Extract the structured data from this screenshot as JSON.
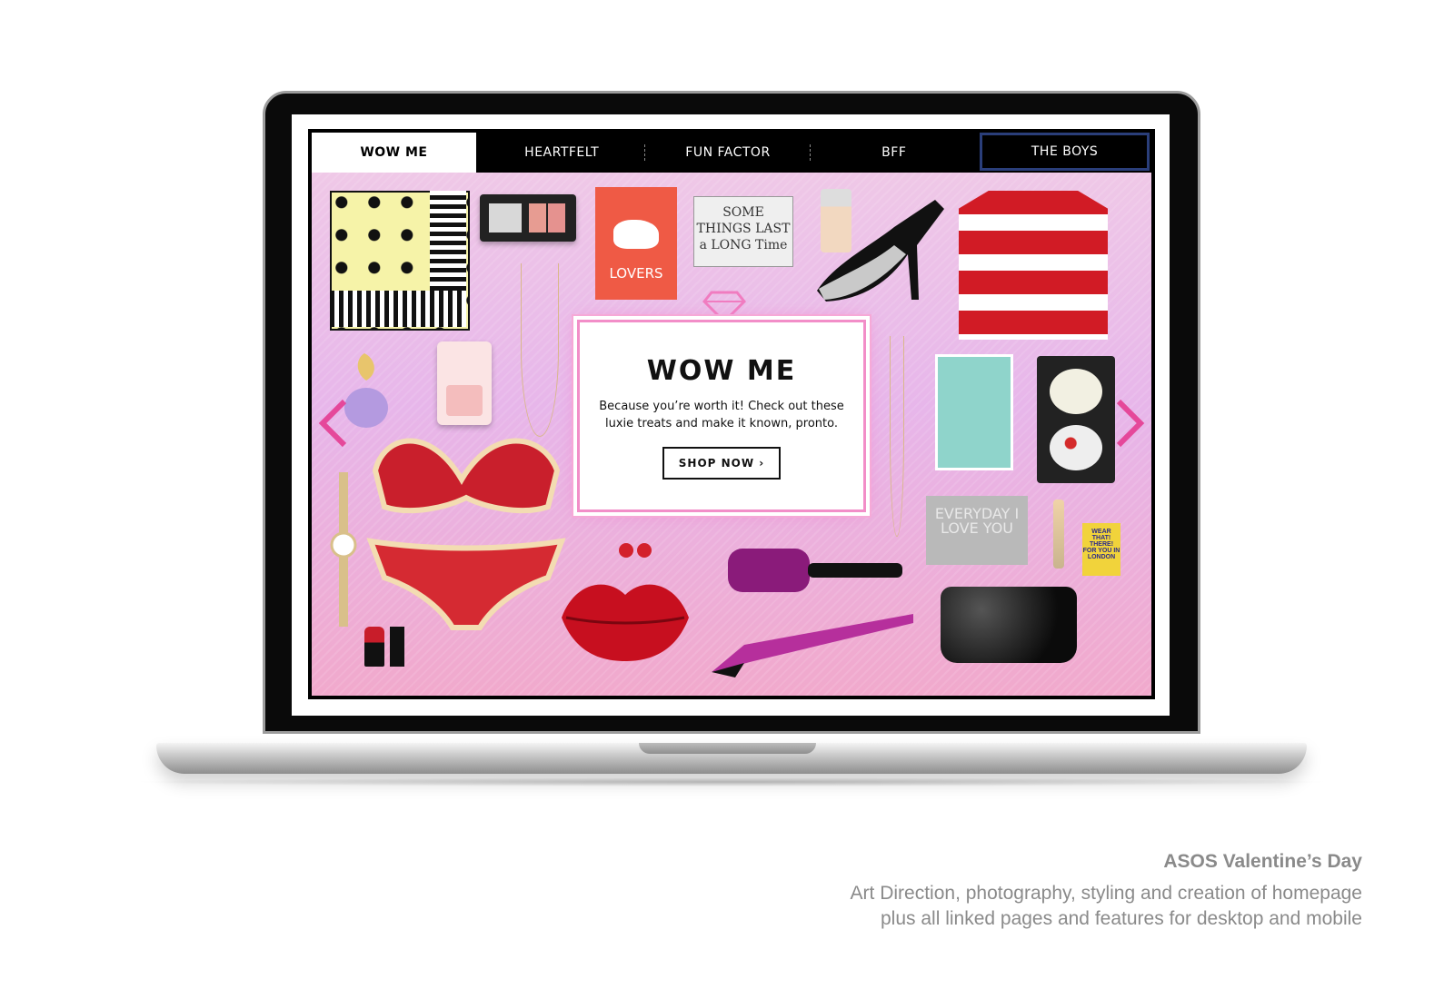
{
  "nav": {
    "tabs": [
      {
        "label": "WOW ME"
      },
      {
        "label": "HEARTFELT"
      },
      {
        "label": "FUN FACTOR"
      },
      {
        "label": "BFF"
      },
      {
        "label": "THE BOYS"
      }
    ]
  },
  "products": {
    "card_bear_text": "LOVERS",
    "card_text_quote": "SOME THINGS LAST a LONG Time",
    "card_everyday_text": "EVERYDAY I LOVE YOU",
    "book_text": "WEAR THAT! THERE! FOR YOU IN LONDON"
  },
  "promo": {
    "title": "WOW ME",
    "text": "Because you’re worth it! Check out these luxie treats and make it known, pronto.",
    "button_label": "SHOP NOW ›"
  },
  "caption": {
    "title": "ASOS Valentine’s Day",
    "line1": "Art Direction, photography, styling and creation of homepage",
    "line2": "plus all linked pages and features for desktop and mobile"
  },
  "colors": {
    "accent_pink": "#f28ec8",
    "nav_boys_border": "#2a3e7a",
    "caption_gray": "#8a8a8a"
  }
}
